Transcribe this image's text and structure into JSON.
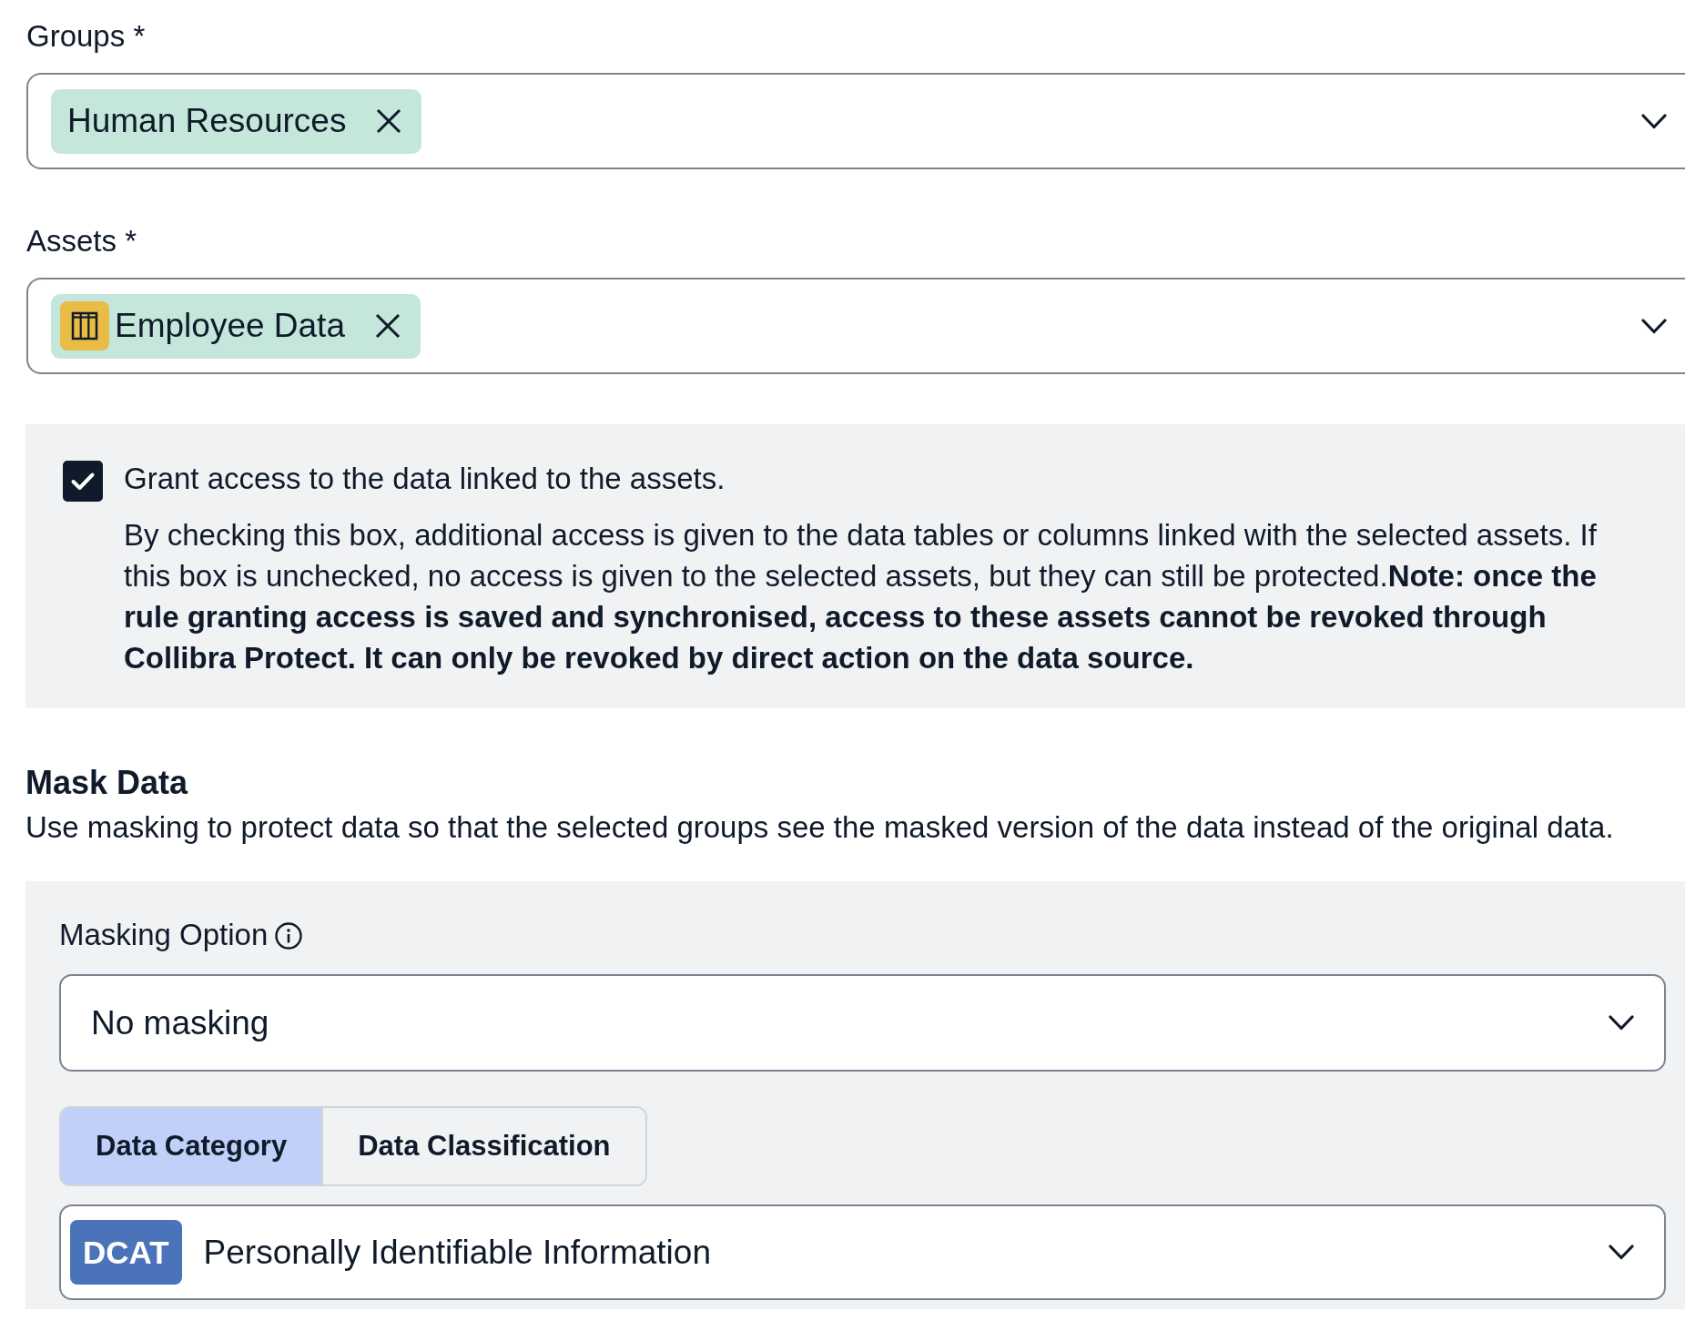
{
  "fields": [
    {
      "label": "Groups *",
      "chips": [
        {
          "label": "Human Resources",
          "kind": "group"
        }
      ]
    },
    {
      "label": "Assets *",
      "chips": [
        {
          "label": "Employee Data",
          "kind": "asset"
        }
      ]
    }
  ],
  "grant_access": {
    "checked": true,
    "label": "Grant access to the data linked to the assets.",
    "description": "By checking this box, additional access is given to the data tables or columns linked with the selected assets. If this box is unchecked, no access is given to the selected assets, but they can still be protected.**Note: once the rule granting access is saved and synchronised, access to these assets cannot be revoked through Collibra Protect. It can only be revoked by direct action on the data source.**"
  },
  "mask_data": {
    "title": "Mask Data",
    "description": "Use masking to protect data so that the selected groups see the masked version of the data instead of the original data.",
    "masking_option": {
      "label": "Masking Option",
      "value": "No masking"
    },
    "tabs": [
      {
        "label": "Data Category",
        "selected": true
      },
      {
        "label": "Data Classification",
        "selected": false
      }
    ],
    "category_select": {
      "badge": "DCAT",
      "value": "Personally Identifiable Information"
    }
  }
}
